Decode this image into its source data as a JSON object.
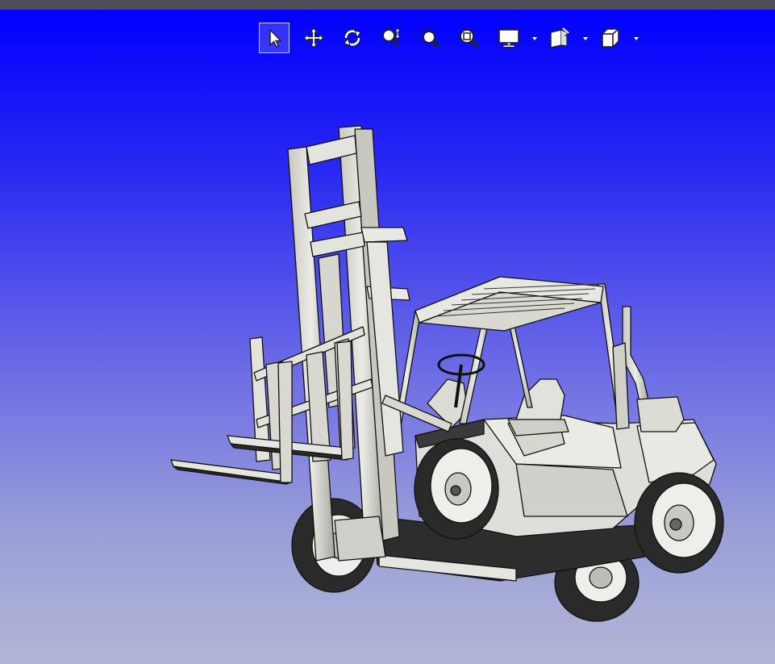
{
  "window": {
    "title_strip_color": "#4f4f57"
  },
  "viewport": {
    "background_top": "#0000ff",
    "background_bottom": "#b3b6d6",
    "model_name": "forklift"
  },
  "toolbar": {
    "tools": [
      {
        "id": "select",
        "icon": "select-arrow-icon",
        "active": true
      },
      {
        "id": "pan",
        "icon": "pan-move-icon",
        "active": false
      },
      {
        "id": "rotate",
        "icon": "rotate-icon",
        "active": false
      },
      {
        "id": "zoom",
        "icon": "zoom-updown-icon",
        "active": false
      },
      {
        "id": "zoom-window",
        "icon": "zoom-window-icon",
        "active": false
      },
      {
        "id": "zoom-fit",
        "icon": "zoom-fit-icon",
        "active": false
      },
      {
        "id": "display",
        "icon": "display-monitor-icon",
        "has_dropdown": true
      },
      {
        "id": "section",
        "icon": "section-plane-icon",
        "has_dropdown": true
      },
      {
        "id": "view-cube",
        "icon": "view-cube-icon",
        "has_dropdown": true
      }
    ]
  }
}
